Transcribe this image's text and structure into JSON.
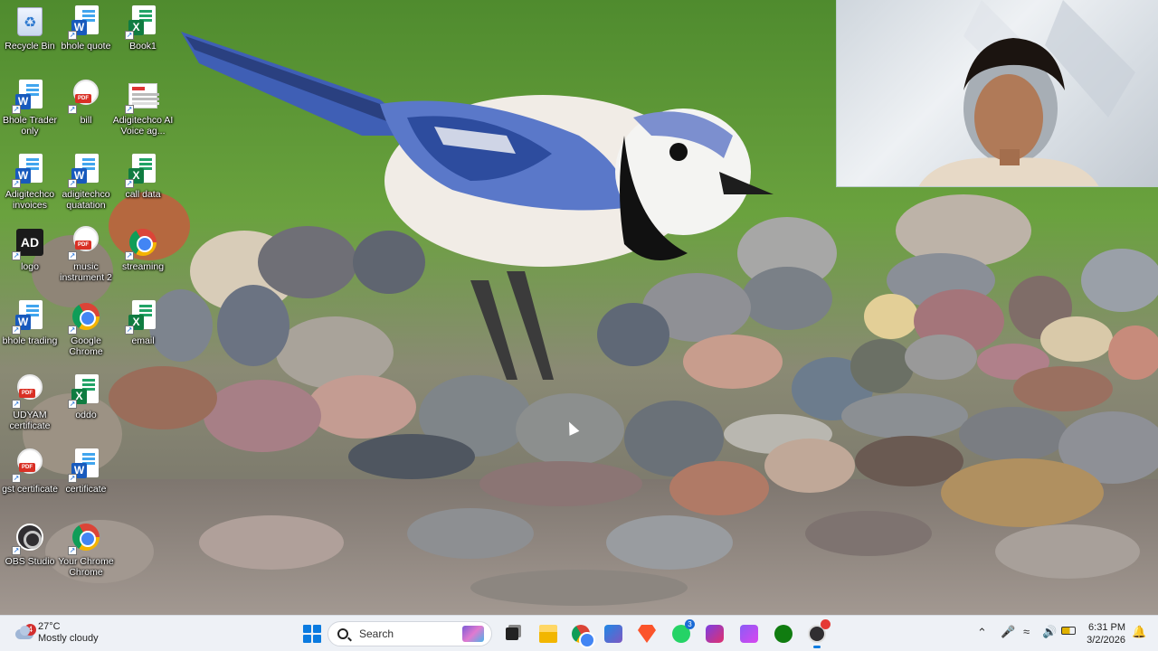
{
  "desktop": {
    "icons": [
      {
        "label": "Recycle Bin",
        "icon": "recycle-bin-icon"
      },
      {
        "label": "bhole quote",
        "icon": "word-doc-icon"
      },
      {
        "label": "Book1",
        "icon": "excel-doc-icon"
      },
      {
        "label": "Bhole Trader only",
        "icon": "word-doc-icon"
      },
      {
        "label": "bill",
        "icon": "pdf-doc-icon"
      },
      {
        "label": "Adigitechco AI Voice ag...",
        "icon": "webpage-thumbnail-icon"
      },
      {
        "label": "Adigitechco invoices",
        "icon": "word-doc-icon"
      },
      {
        "label": "adigitechco quatation",
        "icon": "word-doc-icon"
      },
      {
        "label": "call data",
        "icon": "excel-doc-icon"
      },
      {
        "label": "logo",
        "icon": "logo-image-icon"
      },
      {
        "label": "music instrument 2",
        "icon": "pdf-doc-icon"
      },
      {
        "label": "streaming",
        "icon": "chrome-app-icon"
      },
      {
        "label": "bhole trading",
        "icon": "word-doc-icon"
      },
      {
        "label": "Google Chrome",
        "icon": "chrome-icon"
      },
      {
        "label": "email",
        "icon": "excel-doc-icon"
      },
      {
        "label": "UDYAM certificate",
        "icon": "pdf-doc-icon"
      },
      {
        "label": "oddo",
        "icon": "excel-doc-icon"
      },
      {
        "label": "gst certificate",
        "icon": "pdf-doc-icon"
      },
      {
        "label": "certificate",
        "icon": "word-doc-icon"
      },
      {
        "label": "OBS Studio",
        "icon": "obs-icon"
      },
      {
        "label": "Your Chrome Chrome",
        "icon": "chrome-app-icon"
      }
    ]
  },
  "taskbar": {
    "weather": {
      "temp": "27°C",
      "condition": "Mostly cloudy",
      "alert_count": "4"
    },
    "search": {
      "placeholder": "Search"
    },
    "whatsapp_badge": "3",
    "clock": {
      "time": "6:31 PM",
      "date": "3/2/2026"
    },
    "pinned": [
      "start-icon",
      "search-box",
      "task-view-icon",
      "file-explorer-icon",
      "chrome-icon",
      "store-icon",
      "brave-icon",
      "whatsapp-icon",
      "instagram-icon",
      "clipchamp-icon",
      "xbox-icon",
      "obs-running-icon"
    ],
    "tray": [
      "chevron-up-icon",
      "microphone-icon",
      "wifi-icon",
      "volume-icon",
      "battery-icon",
      "notification-icon"
    ]
  },
  "colors": {
    "accent": "#0b7be0",
    "word": "#185abd",
    "excel": "#107c41",
    "pdf": "#d93025"
  }
}
